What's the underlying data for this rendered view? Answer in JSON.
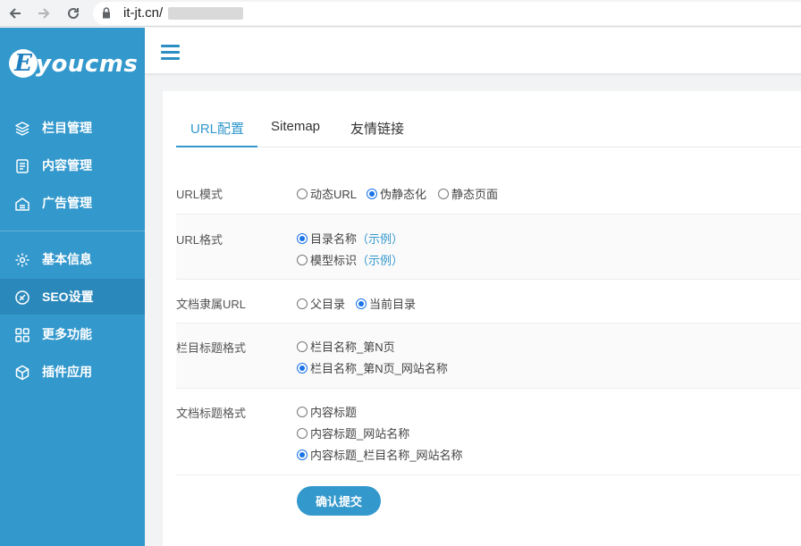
{
  "browser": {
    "url": "it-jt.cn/",
    "back_icon": "arrow-left-icon",
    "forward_icon": "arrow-right-icon",
    "reload_icon": "reload-icon"
  },
  "logo": {
    "letter": "E",
    "text": "youcms"
  },
  "sidebar": {
    "items": [
      {
        "label": "栏目管理",
        "icon": "layers-icon"
      },
      {
        "label": "内容管理",
        "icon": "document-icon"
      },
      {
        "label": "广告管理",
        "icon": "ad-icon"
      },
      {
        "label": "基本信息",
        "icon": "gear-icon"
      },
      {
        "label": "SEO设置",
        "icon": "seo-icon",
        "active": true
      },
      {
        "label": "更多功能",
        "icon": "grid-icon"
      },
      {
        "label": "插件应用",
        "icon": "cube-icon"
      }
    ]
  },
  "tabs": [
    {
      "label": "URL配置",
      "active": true
    },
    {
      "label": "Sitemap"
    },
    {
      "label": "友情链接"
    }
  ],
  "form": {
    "url_mode": {
      "label": "URL模式",
      "options": [
        "动态URL",
        "伪静态化",
        "静态页面"
      ],
      "selected": 1
    },
    "url_format": {
      "label": "URL格式",
      "options": [
        "目录名称",
        "模型标识"
      ],
      "example": "（示例）",
      "selected": 0
    },
    "doc_url": {
      "label": "文档隶属URL",
      "options": [
        "父目录",
        "当前目录"
      ],
      "selected": 1
    },
    "column_title": {
      "label": "栏目标题格式",
      "options": [
        "栏目名称_第N页",
        "栏目名称_第N页_网站名称"
      ],
      "selected": 1
    },
    "doc_title": {
      "label": "文档标题格式",
      "options": [
        "内容标题",
        "内容标题_网站名称",
        "内容标题_栏目名称_网站名称"
      ],
      "selected": 2
    },
    "submit_label": "确认提交"
  },
  "colors": {
    "primary": "#3398cc",
    "active_menu": "#2a88bb",
    "radio_checked": "#1a73e8"
  }
}
